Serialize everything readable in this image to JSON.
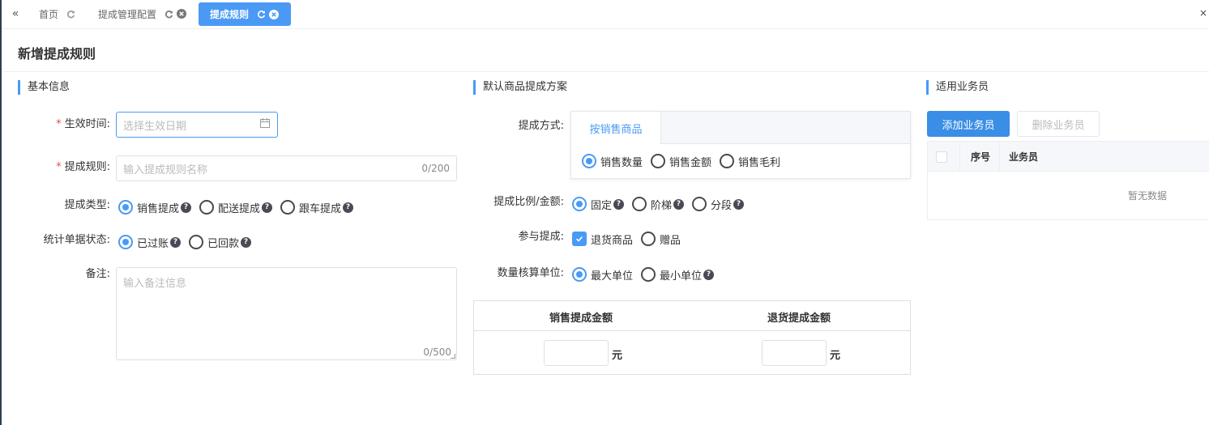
{
  "tabs": [
    {
      "label": "首页"
    },
    {
      "label": "提成管理配置"
    },
    {
      "label": "提成规则"
    }
  ],
  "page": {
    "title": "新增提成规则"
  },
  "sections": {
    "basic": "基本信息",
    "scheme": "默认商品提成方案",
    "staff": "适用业务员"
  },
  "basic": {
    "effective_label": "生效时间:",
    "effective_placeholder": "选择生效日期",
    "rule_label": "提成规则:",
    "rule_placeholder": "输入提成规则名称",
    "rule_count": "0/200",
    "type_label": "提成类型:",
    "type_options": [
      "销售提成",
      "配送提成",
      "跟车提成"
    ],
    "type_selected": 0,
    "status_label": "统计单据状态:",
    "status_options": [
      "已过账",
      "已回款"
    ],
    "status_selected": 0,
    "remark_label": "备注:",
    "remark_placeholder": "输入备注信息",
    "remark_count": "0/500"
  },
  "scheme": {
    "method_label": "提成方式:",
    "method_tab": "按销售商品",
    "method_options": [
      "销售数量",
      "销售金额",
      "销售毛利"
    ],
    "method_selected": 0,
    "ratio_label": "提成比例/金额:",
    "ratio_options": [
      "固定",
      "阶梯",
      "分段"
    ],
    "ratio_selected": 0,
    "participate_label": "参与提成:",
    "participate_options": [
      "退货商品",
      "赠品"
    ],
    "participate_checked": [
      true,
      false
    ],
    "unit_label": "数量核算单位:",
    "unit_options": [
      "最大单位",
      "最小单位"
    ],
    "unit_selected": 0,
    "amount_headers": [
      "销售提成金额",
      "退货提成金额"
    ],
    "currency": "元"
  },
  "staff": {
    "add_button": "添加业务员",
    "delete_button": "删除业务员",
    "columns": [
      "序号",
      "业务员"
    ],
    "empty_text": "暂无数据"
  }
}
